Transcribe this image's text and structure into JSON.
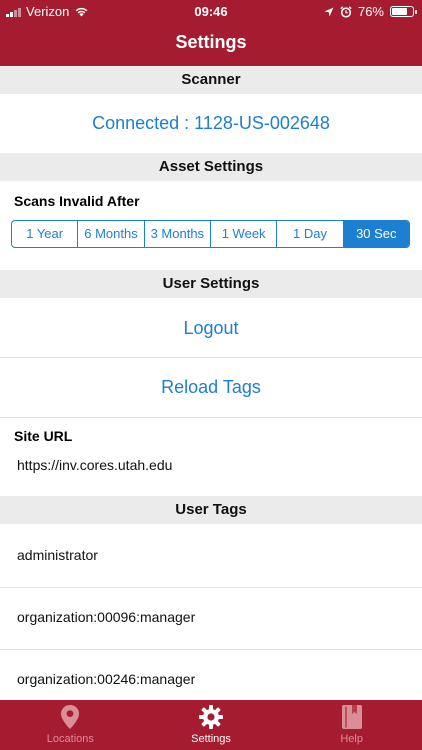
{
  "status_bar": {
    "carrier": "Verizon",
    "time": "09:46",
    "battery": "76%",
    "battery_level": 0.76
  },
  "nav": {
    "title": "Settings"
  },
  "scanner": {
    "header": "Scanner",
    "connection": "Connected : 1128-US-002648"
  },
  "asset_settings": {
    "header": "Asset Settings",
    "label": "Scans Invalid After",
    "options": [
      "1 Year",
      "6 Months",
      "3 Months",
      "1 Week",
      "1 Day",
      "30 Sec"
    ],
    "selected": "30 Sec"
  },
  "user_settings": {
    "header": "User Settings",
    "logout_label": "Logout",
    "reload_label": "Reload Tags",
    "site_url_label": "Site URL",
    "site_url": "https://inv.cores.utah.edu"
  },
  "user_tags": {
    "header": "User Tags",
    "items": [
      "administrator",
      "organization:00096:manager",
      "organization:00246:manager"
    ]
  },
  "tabbar": {
    "items": [
      {
        "label": "Locations",
        "icon": "location-pin-icon",
        "active": false
      },
      {
        "label": "Settings",
        "icon": "gear-icon",
        "active": true
      },
      {
        "label": "Help",
        "icon": "book-icon",
        "active": false
      }
    ]
  },
  "colors": {
    "brand": "#a51c30",
    "accent": "#1d7fd1",
    "section_bg": "#ebebeb"
  }
}
